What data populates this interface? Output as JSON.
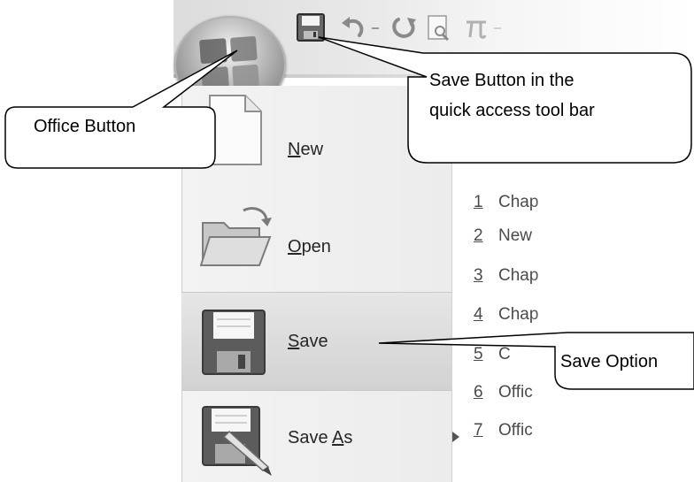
{
  "menu": {
    "items": [
      {
        "mnemonic": "N",
        "rest": "ew",
        "icon": "new-document-icon"
      },
      {
        "mnemonic": "O",
        "rest": "pen",
        "icon": "open-folder-icon"
      },
      {
        "mnemonic": "S",
        "rest": "ave",
        "icon": "save-disk-icon"
      },
      {
        "prefix": "Save ",
        "mnemonic": "A",
        "rest": "s",
        "icon": "save-as-icon"
      }
    ],
    "recent": [
      {
        "num": "1",
        "name": "Chap"
      },
      {
        "num": "2",
        "name": "New"
      },
      {
        "num": "3",
        "name": "Chap"
      },
      {
        "num": "4",
        "name": "Chap"
      },
      {
        "num": "5",
        "name": "C"
      },
      {
        "num": "6",
        "name": "Offic"
      },
      {
        "num": "7",
        "name": "Offic"
      }
    ]
  },
  "callouts": {
    "office_button": "Office Button",
    "save_button_line1": "Save Button in the",
    "save_button_line2": "quick access tool bar",
    "save_option": "Save Option"
  },
  "colors": {
    "ribbon": "#dcdcdc",
    "menu_bg": "#f3f3f3",
    "highlight": "#d2d2d2",
    "text": "#262626"
  }
}
